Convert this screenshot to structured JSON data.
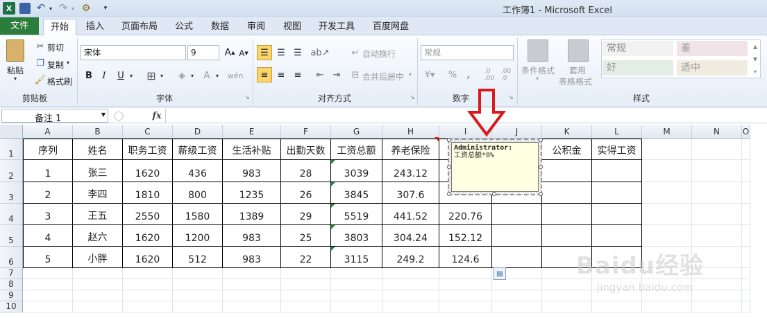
{
  "window": {
    "title": "工作簿1 - Microsoft Excel"
  },
  "tabs": [
    "文件",
    "开始",
    "插入",
    "页面布局",
    "公式",
    "数据",
    "审阅",
    "视图",
    "开发工具",
    "百度网盘"
  ],
  "active_tab": "开始",
  "ribbon": {
    "clipboard": {
      "paste": "粘贴",
      "cut": "剪切",
      "copy": "复制",
      "format_painter": "格式刷",
      "label": "剪贴板"
    },
    "font": {
      "name": "宋体",
      "size": "9",
      "label": "字体"
    },
    "alignment": {
      "wrap": "自动换行",
      "merge": "合并后居中",
      "label": "对齐方式"
    },
    "number": {
      "format": "常规",
      "label": "数字"
    },
    "styles": {
      "conditional": "条件格式",
      "table_format_1": "套用",
      "table_format_2": "表格格式",
      "normal": "常规",
      "bad": "差",
      "good": "好",
      "neutral": "适中",
      "label": "样式"
    }
  },
  "formula_bar": {
    "name_box": "备注 1",
    "fx": "fx",
    "value": ""
  },
  "columns": [
    "A",
    "B",
    "C",
    "D",
    "E",
    "F",
    "G",
    "H",
    "I",
    "J",
    "K",
    "L",
    "M",
    "N",
    "O"
  ],
  "rows": [
    "1",
    "2",
    "3",
    "4",
    "5",
    "6",
    "7",
    "8",
    "9",
    "10"
  ],
  "table": {
    "headers": [
      "序列",
      "姓名",
      "职务工资",
      "薪级工资",
      "生活补贴",
      "出勤天数",
      "工资总额",
      "养老保险",
      "",
      "",
      "公积金",
      "实得工资"
    ],
    "rows": [
      [
        "1",
        "张三",
        "1620",
        "436",
        "983",
        "28",
        "3039",
        "243.12",
        "",
        "",
        "",
        ""
      ],
      [
        "2",
        "李四",
        "1810",
        "800",
        "1235",
        "26",
        "3845",
        "307.6",
        "",
        "",
        "",
        ""
      ],
      [
        "3",
        "王五",
        "2550",
        "1580",
        "1389",
        "29",
        "5519",
        "441.52",
        "220.76",
        "",
        "",
        ""
      ],
      [
        "4",
        "赵六",
        "1620",
        "1200",
        "983",
        "25",
        "3803",
        "304.24",
        "152.12",
        "",
        "",
        ""
      ],
      [
        "5",
        "小胖",
        "1620",
        "512",
        "983",
        "22",
        "3115",
        "249.2",
        "124.6",
        "",
        "",
        ""
      ]
    ]
  },
  "comment": {
    "author": "Administrator:",
    "text": "工资总额*8%"
  },
  "watermark": {
    "brand": "Baidu经验",
    "url": "jingyan.baidu.com"
  },
  "colors": {
    "file_tab": "#2a7d3b",
    "accent_arrow": "#d9191c",
    "comment_bg": "#ffffe1"
  }
}
